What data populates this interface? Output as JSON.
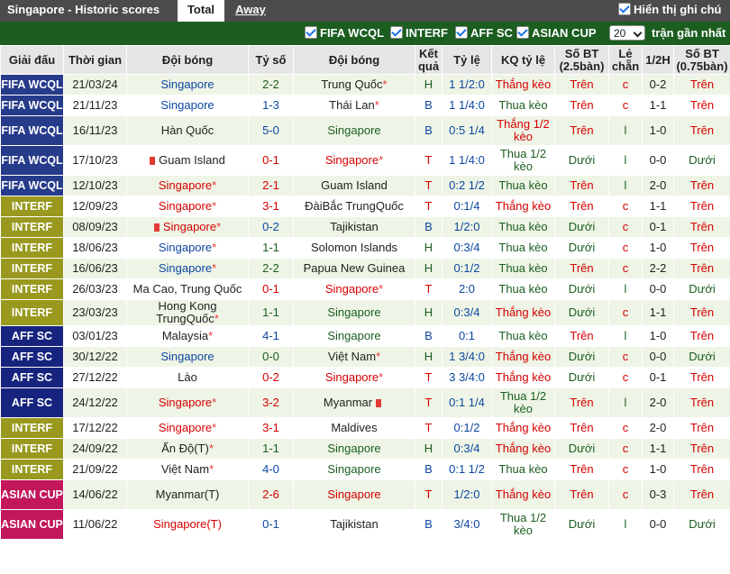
{
  "header": {
    "title": "Singapore - Historic scores",
    "tab_total": "Total",
    "tab_away": "Away",
    "show_notes": "Hiển thị ghi chú"
  },
  "filters": {
    "items": [
      "FIFA WCQL",
      "INTERF",
      "AFF SC",
      "ASIAN CUP"
    ],
    "count_value": "20",
    "count_suffix": "trận gần nhất"
  },
  "columns": [
    "Giải đấu",
    "Thời gian",
    "Đội bóng",
    "Tỷ số",
    "Đội bóng",
    "Kết quả",
    "Tỷ lệ",
    "KQ tỷ lệ",
    "Số BT (2.5bàn)",
    "Lẻ chẵn",
    "1/2H",
    "Số BT (0.75bàn)"
  ],
  "colors": {
    "FIFA WCQL": "#263b8a",
    "INTERF": "#99991f",
    "AFF SC": "#16247e",
    "ASIAN CUP": "#c2185b",
    "win": "#d50000",
    "lose": "#1b5e20",
    "home_team": "#0d47a1"
  },
  "rows": [
    {
      "league": "FIFA WCQL",
      "date": "21/03/24",
      "home": "Singapore",
      "score": "2-2",
      "away": "Trung Quốc",
      "venue": "H",
      "odds": "1 1/2:0",
      "odds_result": "Thắng kèo",
      "ou": "Trên",
      "oe": "c",
      "half": "0-2",
      "ou2": "Trên"
    },
    {
      "league": "FIFA WCQL",
      "date": "21/11/23",
      "home": "Singapore",
      "score": "1-3",
      "away": "Thái Lan",
      "venue": "B",
      "odds": "1 1/4:0",
      "odds_result": "Thua kèo",
      "ou": "Trên",
      "oe": "c",
      "half": "1-1",
      "ou2": "Trên"
    },
    {
      "league": "FIFA WCQL",
      "date": "16/11/23",
      "home": "Hàn Quốc",
      "score": "5-0",
      "away": "Singapore",
      "venue": "B",
      "odds": "0:5 1/4",
      "odds_result": "Thắng 1/2 kèo",
      "ou": "Trên",
      "oe": "l",
      "half": "1-0",
      "ou2": "Trên"
    },
    {
      "league": "FIFA WCQL",
      "date": "17/10/23",
      "home": "Guam Island",
      "score": "0-1",
      "away": "Singapore",
      "venue": "T",
      "odds": "1 1/4:0",
      "odds_result": "Thua 1/2 kèo",
      "ou": "Dưới",
      "oe": "l",
      "half": "0-0",
      "ou2": "Dưới"
    },
    {
      "league": "FIFA WCQL",
      "date": "12/10/23",
      "home": "Singapore",
      "score": "2-1",
      "away": "Guam Island",
      "venue": "T",
      "odds": "0:2 1/2",
      "odds_result": "Thua kèo",
      "ou": "Trên",
      "oe": "l",
      "half": "2-0",
      "ou2": "Trên"
    },
    {
      "league": "INTERF",
      "date": "12/09/23",
      "home": "Singapore",
      "score": "3-1",
      "away": "ĐàiBắc TrungQuốc",
      "venue": "T",
      "odds": "0:1/4",
      "odds_result": "Thắng kèo",
      "ou": "Trên",
      "oe": "c",
      "half": "1-1",
      "ou2": "Trên"
    },
    {
      "league": "INTERF",
      "date": "08/09/23",
      "home": "Singapore",
      "score": "0-2",
      "away": "Tajikistan",
      "venue": "B",
      "odds": "1/2:0",
      "odds_result": "Thua kèo",
      "ou": "Dưới",
      "oe": "c",
      "half": "0-1",
      "ou2": "Trên"
    },
    {
      "league": "INTERF",
      "date": "18/06/23",
      "home": "Singapore",
      "score": "1-1",
      "away": "Solomon Islands",
      "venue": "H",
      "odds": "0:3/4",
      "odds_result": "Thua kèo",
      "ou": "Dưới",
      "oe": "c",
      "half": "1-0",
      "ou2": "Trên"
    },
    {
      "league": "INTERF",
      "date": "16/06/23",
      "home": "Singapore",
      "score": "2-2",
      "away": "Papua New Guinea",
      "venue": "H",
      "odds": "0:1/2",
      "odds_result": "Thua kèo",
      "ou": "Trên",
      "oe": "c",
      "half": "2-2",
      "ou2": "Trên"
    },
    {
      "league": "INTERF",
      "date": "26/03/23",
      "home": "Ma Cao, Trung Quốc",
      "score": "0-1",
      "away": "Singapore",
      "venue": "T",
      "odds": "2:0",
      "odds_result": "Thua kèo",
      "ou": "Dưới",
      "oe": "l",
      "half": "0-0",
      "ou2": "Dưới"
    },
    {
      "league": "INTERF",
      "date": "23/03/23",
      "home": "Hong Kong TrungQuốc",
      "score": "1-1",
      "away": "Singapore",
      "venue": "H",
      "odds": "0:3/4",
      "odds_result": "Thắng kèo",
      "ou": "Dưới",
      "oe": "c",
      "half": "1-1",
      "ou2": "Trên"
    },
    {
      "league": "AFF SC",
      "date": "03/01/23",
      "home": "Malaysia",
      "score": "4-1",
      "away": "Singapore",
      "venue": "B",
      "odds": "0:1",
      "odds_result": "Thua kèo",
      "ou": "Trên",
      "oe": "l",
      "half": "1-0",
      "ou2": "Trên"
    },
    {
      "league": "AFF SC",
      "date": "30/12/22",
      "home": "Singapore",
      "score": "0-0",
      "away": "Việt Nam",
      "venue": "H",
      "odds": "1 3/4:0",
      "odds_result": "Thắng kèo",
      "ou": "Dưới",
      "oe": "c",
      "half": "0-0",
      "ou2": "Dưới"
    },
    {
      "league": "AFF SC",
      "date": "27/12/22",
      "home": "Lào",
      "score": "0-2",
      "away": "Singapore",
      "venue": "T",
      "odds": "3 3/4:0",
      "odds_result": "Thắng kèo",
      "ou": "Dưới",
      "oe": "c",
      "half": "0-1",
      "ou2": "Trên"
    },
    {
      "league": "AFF SC",
      "date": "24/12/22",
      "home": "Singapore",
      "score": "3-2",
      "away": "Myanmar",
      "venue": "T",
      "odds": "0:1 1/4",
      "odds_result": "Thua 1/2 kèo",
      "ou": "Trên",
      "oe": "l",
      "half": "2-0",
      "ou2": "Trên"
    },
    {
      "league": "INTERF",
      "date": "17/12/22",
      "home": "Singapore",
      "score": "3-1",
      "away": "Maldives",
      "venue": "T",
      "odds": "0:1/2",
      "odds_result": "Thắng kèo",
      "ou": "Trên",
      "oe": "c",
      "half": "2-0",
      "ou2": "Trên"
    },
    {
      "league": "INTERF",
      "date": "24/09/22",
      "home": "Ấn Độ(T)",
      "score": "1-1",
      "away": "Singapore",
      "venue": "H",
      "odds": "0:3/4",
      "odds_result": "Thắng kèo",
      "ou": "Dưới",
      "oe": "c",
      "half": "1-1",
      "ou2": "Trên"
    },
    {
      "league": "INTERF",
      "date": "21/09/22",
      "home": "Việt Nam",
      "score": "4-0",
      "away": "Singapore",
      "venue": "B",
      "odds": "0:1 1/2",
      "odds_result": "Thua kèo",
      "ou": "Trên",
      "oe": "c",
      "half": "1-0",
      "ou2": "Trên"
    },
    {
      "league": "ASIAN CUP",
      "date": "14/06/22",
      "home": "Myanmar(T)",
      "score": "2-6",
      "away": "Singapore",
      "venue": "T",
      "odds": "1/2:0",
      "odds_result": "Thắng kèo",
      "ou": "Trên",
      "oe": "c",
      "half": "0-3",
      "ou2": "Trên"
    },
    {
      "league": "ASIAN CUP",
      "date": "11/06/22",
      "home": "Singapore(T)",
      "score": "0-1",
      "away": "Tajikistan",
      "venue": "B",
      "odds": "3/4:0",
      "odds_result": "Thua 1/2 kèo",
      "ou": "Dưới",
      "oe": "l",
      "half": "0-0",
      "ou2": "Dưới"
    }
  ]
}
